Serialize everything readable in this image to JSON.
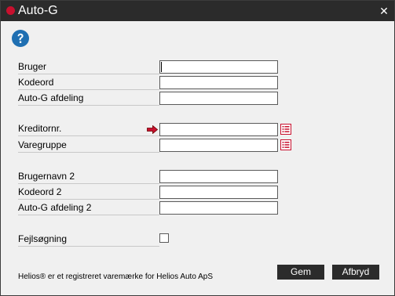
{
  "window": {
    "title": "Auto-G",
    "close_glyph": "✕"
  },
  "help": {
    "icon": "help-question-icon",
    "color": "#1f6fb2"
  },
  "fields": {
    "bruger": {
      "label": "Bruger",
      "value": ""
    },
    "kodeord": {
      "label": "Kodeord",
      "value": ""
    },
    "afdeling": {
      "label": "Auto-G afdeling",
      "value": ""
    },
    "kreditornr": {
      "label": "Kreditornr.",
      "value": ""
    },
    "varegruppe": {
      "label": "Varegruppe",
      "value": ""
    },
    "brugernavn2": {
      "label": "Brugernavn 2",
      "value": ""
    },
    "kodeord2": {
      "label": "Kodeord 2",
      "value": ""
    },
    "afdeling2": {
      "label": "Auto-G afdeling 2",
      "value": ""
    },
    "fejlsogning": {
      "label": "Fejlsøgning",
      "checked": false
    }
  },
  "footer": {
    "trademark": "Helios® er et registreret varemærke for Helios Auto ApS"
  },
  "buttons": {
    "save": "Gem",
    "cancel": "Afbryd"
  },
  "colors": {
    "titlebar": "#2b2b2b",
    "brand_red": "#c8102e",
    "button_bg": "#2b2b2b",
    "arrow_red": "#c8102e"
  }
}
